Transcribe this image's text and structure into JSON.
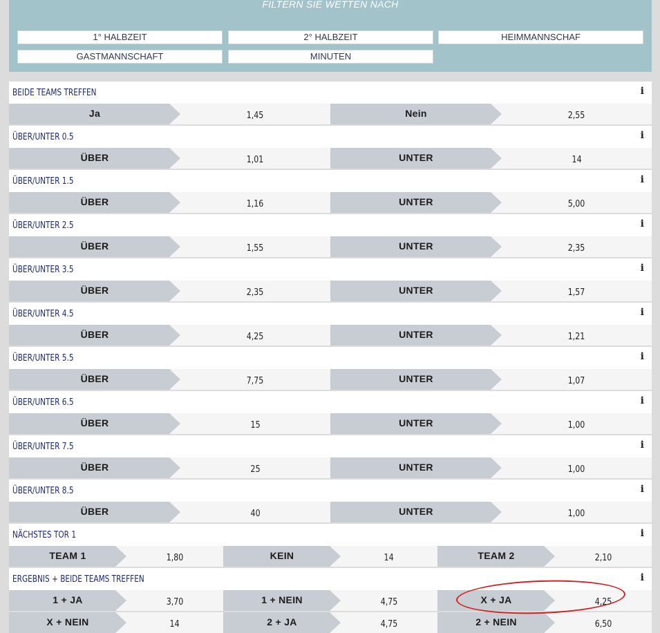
{
  "filter": {
    "title": "FILTERN SIE WETTEN NACH",
    "buttons": [
      "1° HALBZEIT",
      "2° HALBZEIT",
      "HEIMMANNSCHAF",
      "GASTMANNSCHAFT",
      "MINUTEN"
    ]
  },
  "markets": [
    {
      "title": "BEIDE TEAMS TREFFEN",
      "info": "i",
      "rows": [
        [
          {
            "label": "Ja",
            "odd": "1,45"
          },
          {
            "label": "Nein",
            "odd": "2,55"
          }
        ]
      ]
    },
    {
      "title": "ÜBER/UNTER 0.5",
      "info": "i",
      "rows": [
        [
          {
            "label": "ÜBER",
            "odd": "1,01"
          },
          {
            "label": "UNTER",
            "odd": "14"
          }
        ]
      ]
    },
    {
      "title": "ÜBER/UNTER 1.5",
      "info": "i",
      "rows": [
        [
          {
            "label": "ÜBER",
            "odd": "1,16"
          },
          {
            "label": "UNTER",
            "odd": "5,00"
          }
        ]
      ]
    },
    {
      "title": "ÜBER/UNTER 2.5",
      "info": "i",
      "rows": [
        [
          {
            "label": "ÜBER",
            "odd": "1,55"
          },
          {
            "label": "UNTER",
            "odd": "2,35"
          }
        ]
      ]
    },
    {
      "title": "ÜBER/UNTER 3.5",
      "info": "i",
      "rows": [
        [
          {
            "label": "ÜBER",
            "odd": "2,35"
          },
          {
            "label": "UNTER",
            "odd": "1,57"
          }
        ]
      ]
    },
    {
      "title": "ÜBER/UNTER 4.5",
      "info": "i",
      "rows": [
        [
          {
            "label": "ÜBER",
            "odd": "4,25"
          },
          {
            "label": "UNTER",
            "odd": "1,21"
          }
        ]
      ]
    },
    {
      "title": "ÜBER/UNTER 5.5",
      "info": "i",
      "rows": [
        [
          {
            "label": "ÜBER",
            "odd": "7,75"
          },
          {
            "label": "UNTER",
            "odd": "1,07"
          }
        ]
      ]
    },
    {
      "title": "ÜBER/UNTER 6.5",
      "info": "i",
      "rows": [
        [
          {
            "label": "ÜBER",
            "odd": "15"
          },
          {
            "label": "UNTER",
            "odd": "1,00"
          }
        ]
      ]
    },
    {
      "title": "ÜBER/UNTER 7.5",
      "info": "i",
      "rows": [
        [
          {
            "label": "ÜBER",
            "odd": "25"
          },
          {
            "label": "UNTER",
            "odd": "1,00"
          }
        ]
      ]
    },
    {
      "title": "ÜBER/UNTER 8.5",
      "info": "i",
      "rows": [
        [
          {
            "label": "ÜBER",
            "odd": "40"
          },
          {
            "label": "UNTER",
            "odd": "1,00"
          }
        ]
      ]
    },
    {
      "title": "NÄCHSTES TOR 1",
      "info": "i",
      "rows": [
        [
          {
            "label": "TEAM 1",
            "odd": "1,80"
          },
          {
            "label": "KEIN",
            "odd": "14"
          },
          {
            "label": "TEAM 2",
            "odd": "2,10"
          }
        ]
      ]
    },
    {
      "title": "ERGEBNIS + BEIDE TEAMS TREFFEN",
      "info": "i",
      "rows": [
        [
          {
            "label": "1 + JA",
            "odd": "3,70"
          },
          {
            "label": "1 + NEIN",
            "odd": "4,75"
          },
          {
            "label": "X + JA",
            "odd": "4,25"
          }
        ],
        [
          {
            "label": "X + NEIN",
            "odd": "14"
          },
          {
            "label": "2 + JA",
            "odd": "4,75"
          },
          {
            "label": "2 + NEIN",
            "odd": "6,50"
          }
        ]
      ]
    }
  ]
}
